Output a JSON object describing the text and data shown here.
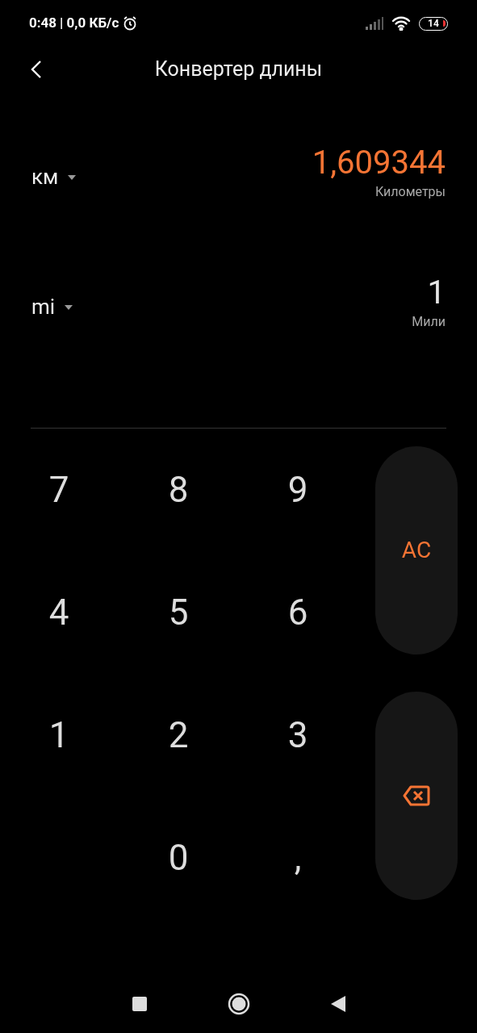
{
  "status_bar": {
    "time": "0:48",
    "speed": "| 0,0 КБ/с",
    "battery": "14"
  },
  "header": {
    "title": "Конвертер длины"
  },
  "units": [
    {
      "unit": "км",
      "value": "1,609344",
      "name": "Километры",
      "selected": true
    },
    {
      "unit": "mi",
      "value": "1",
      "name": "Мили",
      "selected": false
    }
  ],
  "keypad": {
    "keys": [
      "7",
      "8",
      "9",
      "4",
      "5",
      "6",
      "1",
      "2",
      "3",
      "0",
      ","
    ],
    "clear": "AC"
  }
}
